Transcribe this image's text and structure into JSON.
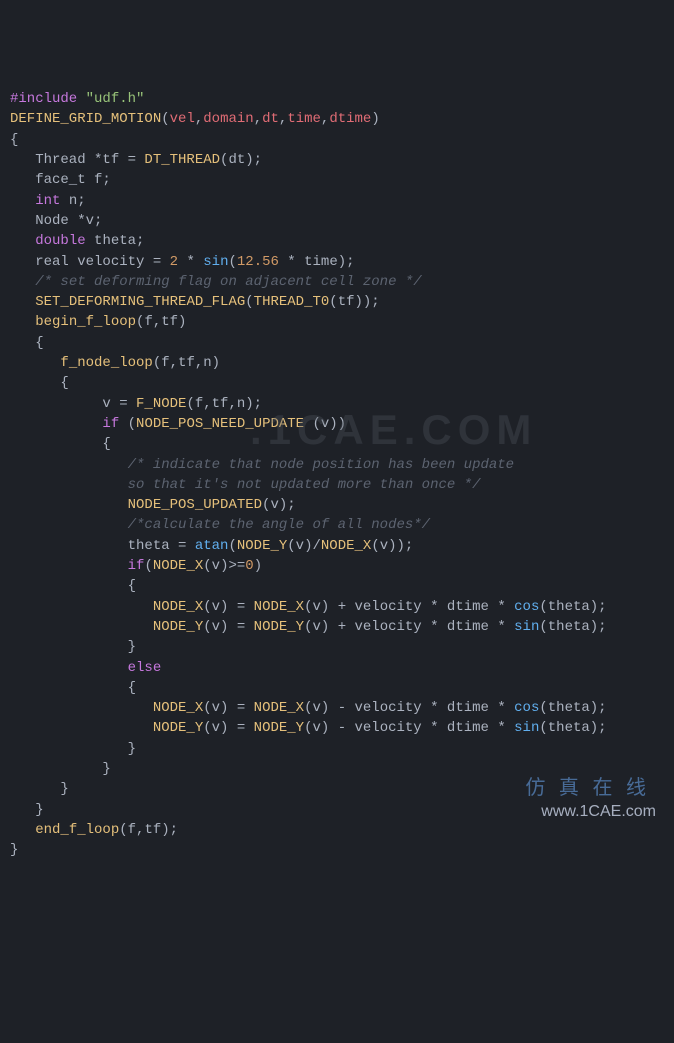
{
  "watermarks": {
    "center": ".1CAE.COM",
    "bottom": "www.1CAE.com",
    "icons": "仿 真 在 线"
  },
  "lines": [
    {
      "segs": [
        [
          "kw",
          "#include"
        ],
        [
          "punc",
          " "
        ],
        [
          "str",
          "\"udf.h\""
        ]
      ]
    },
    {
      "segs": [
        [
          "fn",
          "DEFINE_GRID_MOTION"
        ],
        [
          "punc",
          "("
        ],
        [
          "param",
          "vel"
        ],
        [
          "punc",
          ","
        ],
        [
          "param",
          "domain"
        ],
        [
          "punc",
          ","
        ],
        [
          "param",
          "dt"
        ],
        [
          "punc",
          ","
        ],
        [
          "param",
          "time"
        ],
        [
          "punc",
          ","
        ],
        [
          "param",
          "dtime"
        ],
        [
          "punc",
          ")"
        ]
      ]
    },
    {
      "segs": [
        [
          "punc",
          "{"
        ]
      ]
    },
    {
      "segs": [
        [
          "punc",
          ""
        ]
      ]
    },
    {
      "segs": [
        [
          "punc",
          "   Thread *tf = "
        ],
        [
          "fn",
          "DT_THREAD"
        ],
        [
          "punc",
          "(dt);"
        ]
      ]
    },
    {
      "segs": [
        [
          "punc",
          "   face_t f;"
        ]
      ]
    },
    {
      "segs": [
        [
          "punc",
          "   "
        ],
        [
          "kw",
          "int"
        ],
        [
          "punc",
          " n;"
        ]
      ]
    },
    {
      "segs": [
        [
          "punc",
          ""
        ]
      ]
    },
    {
      "segs": [
        [
          "punc",
          "   Node *v;"
        ]
      ]
    },
    {
      "segs": [
        [
          "punc",
          "   "
        ],
        [
          "kw",
          "double"
        ],
        [
          "punc",
          " theta;"
        ]
      ]
    },
    {
      "segs": [
        [
          "punc",
          "   real velocity = "
        ],
        [
          "num",
          "2"
        ],
        [
          "punc",
          " * "
        ],
        [
          "fn2",
          "sin"
        ],
        [
          "punc",
          "("
        ],
        [
          "num",
          "12.56"
        ],
        [
          "punc",
          " * time);"
        ]
      ]
    },
    {
      "segs": [
        [
          "punc",
          ""
        ]
      ]
    },
    {
      "segs": [
        [
          "punc",
          "   "
        ],
        [
          "comment",
          "/* set deforming flag on adjacent cell zone */"
        ]
      ]
    },
    {
      "segs": [
        [
          "punc",
          "   "
        ],
        [
          "fn",
          "SET_DEFORMING_THREAD_FLAG"
        ],
        [
          "punc",
          "("
        ],
        [
          "fn",
          "THREAD_T0"
        ],
        [
          "punc",
          "(tf));"
        ]
      ]
    },
    {
      "segs": [
        [
          "punc",
          "   "
        ],
        [
          "fn",
          "begin_f_loop"
        ],
        [
          "punc",
          "(f,tf)"
        ]
      ]
    },
    {
      "segs": [
        [
          "punc",
          "   {"
        ]
      ]
    },
    {
      "segs": [
        [
          "punc",
          "      "
        ],
        [
          "fn",
          "f_node_loop"
        ],
        [
          "punc",
          "(f,tf,n)"
        ]
      ]
    },
    {
      "segs": [
        [
          "punc",
          "      {"
        ]
      ]
    },
    {
      "segs": [
        [
          "punc",
          "           v = "
        ],
        [
          "fn",
          "F_NODE"
        ],
        [
          "punc",
          "(f,tf,n);"
        ]
      ]
    },
    {
      "segs": [
        [
          "punc",
          "           "
        ],
        [
          "kw",
          "if"
        ],
        [
          "punc",
          " ("
        ],
        [
          "fn",
          "NODE_POS_NEED_UPDATE"
        ],
        [
          "punc",
          " (v))"
        ]
      ]
    },
    {
      "segs": [
        [
          "punc",
          "           {"
        ]
      ]
    },
    {
      "segs": [
        [
          "punc",
          "              "
        ],
        [
          "comment",
          "/* indicate that node position has been update"
        ]
      ]
    },
    {
      "segs": [
        [
          "punc",
          "              "
        ],
        [
          "comment",
          "so that it's not updated more than once */"
        ]
      ]
    },
    {
      "segs": [
        [
          "punc",
          "              "
        ],
        [
          "fn",
          "NODE_POS_UPDATED"
        ],
        [
          "punc",
          "(v);"
        ]
      ]
    },
    {
      "segs": [
        [
          "punc",
          "              "
        ],
        [
          "comment",
          "/*calculate the angle of all nodes*/"
        ]
      ]
    },
    {
      "segs": [
        [
          "punc",
          "              theta = "
        ],
        [
          "fn2",
          "atan"
        ],
        [
          "punc",
          "("
        ],
        [
          "fn",
          "NODE_Y"
        ],
        [
          "punc",
          "(v)/"
        ],
        [
          "fn",
          "NODE_X"
        ],
        [
          "punc",
          "(v));"
        ]
      ]
    },
    {
      "segs": [
        [
          "punc",
          "              "
        ],
        [
          "kw",
          "if"
        ],
        [
          "punc",
          "("
        ],
        [
          "fn",
          "NODE_X"
        ],
        [
          "punc",
          "(v)>="
        ],
        [
          "num",
          "0"
        ],
        [
          "punc",
          ")"
        ]
      ]
    },
    {
      "segs": [
        [
          "punc",
          "              {"
        ]
      ]
    },
    {
      "segs": [
        [
          "punc",
          "                 "
        ],
        [
          "fn",
          "NODE_X"
        ],
        [
          "punc",
          "(v) = "
        ],
        [
          "fn",
          "NODE_X"
        ],
        [
          "punc",
          "(v) + velocity * dtime * "
        ],
        [
          "fn2",
          "cos"
        ],
        [
          "punc",
          "(theta);"
        ]
      ]
    },
    {
      "segs": [
        [
          "punc",
          "                 "
        ],
        [
          "fn",
          "NODE_Y"
        ],
        [
          "punc",
          "(v) = "
        ],
        [
          "fn",
          "NODE_Y"
        ],
        [
          "punc",
          "(v) + velocity * dtime * "
        ],
        [
          "fn2",
          "sin"
        ],
        [
          "punc",
          "(theta);"
        ]
      ]
    },
    {
      "segs": [
        [
          "punc",
          "              }"
        ]
      ]
    },
    {
      "segs": [
        [
          "punc",
          "              "
        ],
        [
          "kw",
          "else"
        ]
      ]
    },
    {
      "segs": [
        [
          "punc",
          "              {"
        ]
      ]
    },
    {
      "segs": [
        [
          "punc",
          "                 "
        ],
        [
          "fn",
          "NODE_X"
        ],
        [
          "punc",
          "(v) = "
        ],
        [
          "fn",
          "NODE_X"
        ],
        [
          "punc",
          "(v) - velocity * dtime * "
        ],
        [
          "fn2",
          "cos"
        ],
        [
          "punc",
          "(theta);"
        ]
      ]
    },
    {
      "segs": [
        [
          "punc",
          "                 "
        ],
        [
          "fn",
          "NODE_Y"
        ],
        [
          "punc",
          "(v) = "
        ],
        [
          "fn",
          "NODE_Y"
        ],
        [
          "punc",
          "(v) - velocity * dtime * "
        ],
        [
          "fn2",
          "sin"
        ],
        [
          "punc",
          "(theta);"
        ]
      ]
    },
    {
      "segs": [
        [
          "punc",
          "              }"
        ]
      ]
    },
    {
      "segs": [
        [
          "punc",
          "           }"
        ]
      ]
    },
    {
      "segs": [
        [
          "punc",
          "      }"
        ]
      ]
    },
    {
      "segs": [
        [
          "punc",
          "   }"
        ]
      ]
    },
    {
      "segs": [
        [
          "punc",
          "   "
        ],
        [
          "fn",
          "end_f_loop"
        ],
        [
          "punc",
          "(f,tf);"
        ]
      ]
    },
    {
      "segs": [
        [
          "punc",
          "}"
        ]
      ]
    }
  ]
}
